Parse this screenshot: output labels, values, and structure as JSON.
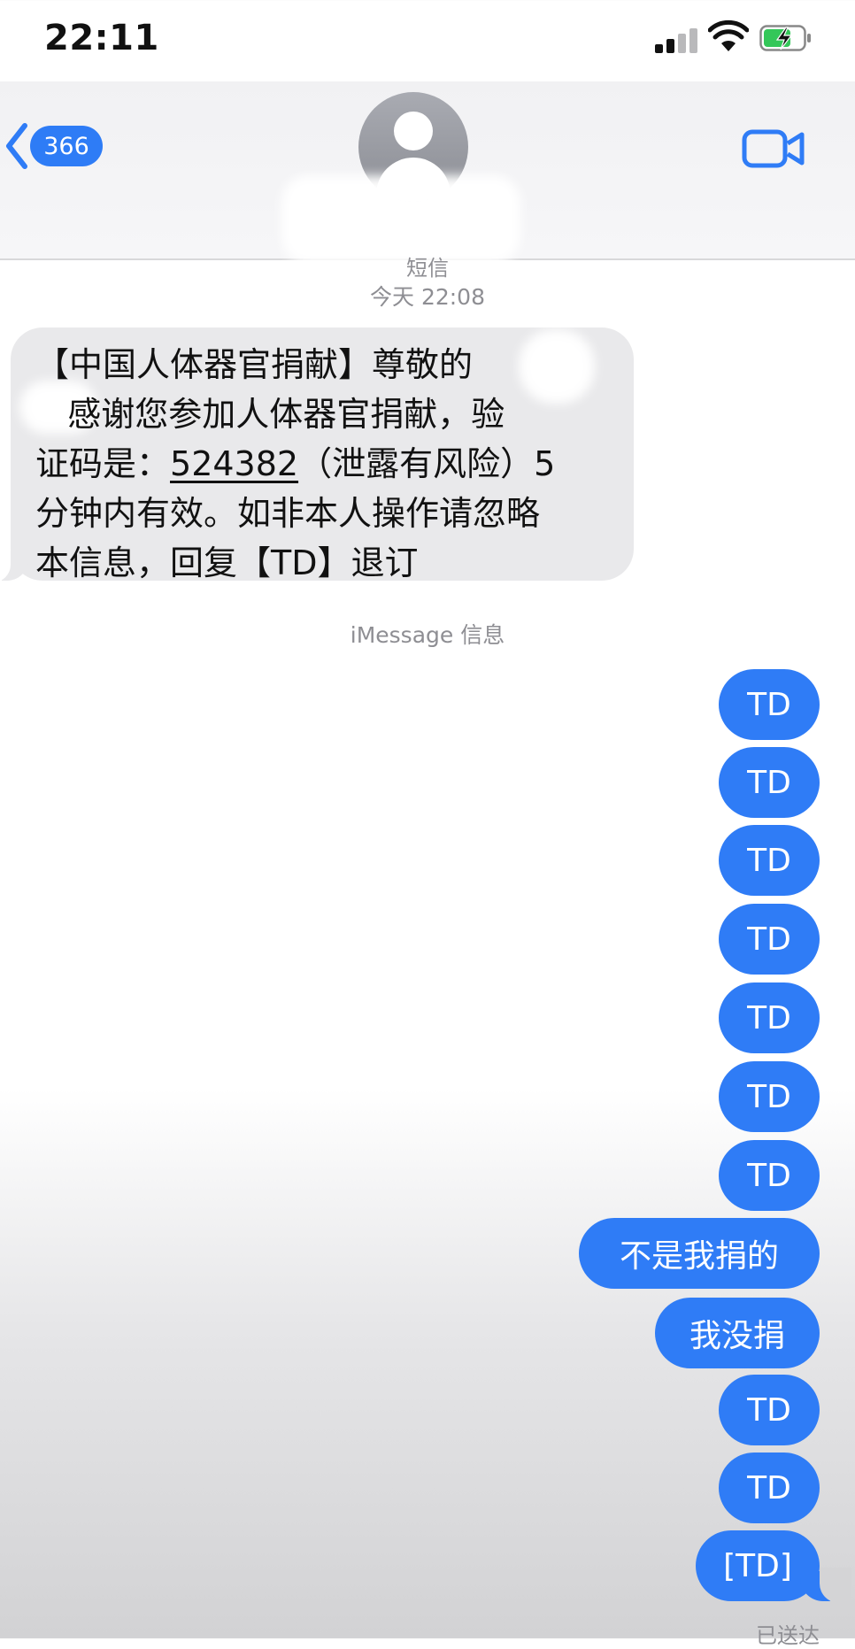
{
  "status_bar": {
    "time": "22:11"
  },
  "header": {
    "back_badge": "366"
  },
  "thread": {
    "message_type": "短信",
    "timestamp": "今天 22:08",
    "incoming_lines": [
      "【中国人体器官捐献】尊敬的",
      "   感谢您参加人体器官捐献，验",
      "证码是：",
      "（泄露有风险）5",
      "分钟内有效。如非本人操作请忽略",
      "本信息，回复【TD】退订"
    ],
    "verification_code": "524382",
    "service_label": "iMessage 信息",
    "outgoing": [
      "TD",
      "TD",
      "TD",
      "TD",
      "TD",
      "TD",
      "TD",
      "不是我捐的",
      "我没捐",
      "TD",
      "TD",
      "[TD]"
    ],
    "delivered": "已送达"
  },
  "colors": {
    "accent_blue": "#2f7cf6",
    "incoming_gray": "#e9e9eb",
    "meta_gray": "#8e8e93"
  },
  "icons": [
    "signal-icon",
    "wifi-icon",
    "battery-charging-icon",
    "back-chevron-icon",
    "avatar-icon",
    "video-call-icon"
  ]
}
